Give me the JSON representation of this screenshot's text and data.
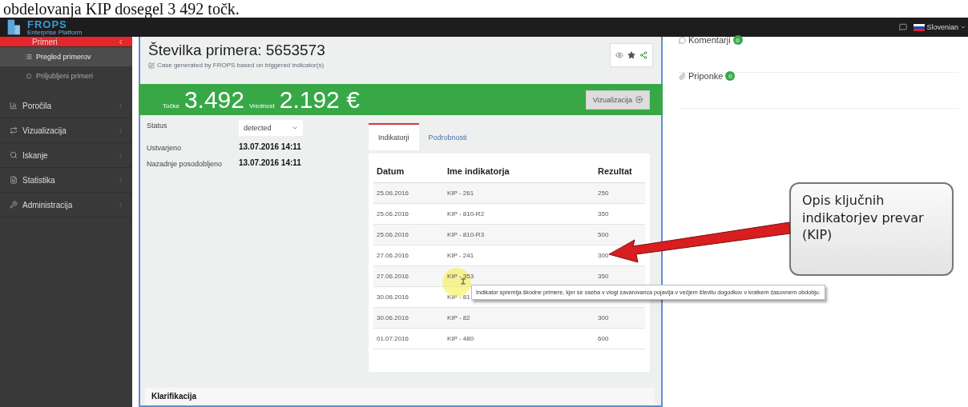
{
  "caption": "obdelovanja KIP dosegel 3 492 točk.",
  "logo": {
    "name": "FROPS",
    "tagline": "Enterprise Platform"
  },
  "header": {
    "language": "Slovenian"
  },
  "sidebar": {
    "items": [
      {
        "label": "Primeri",
        "selected": true,
        "children": [
          {
            "label": "Pregled primerov",
            "selected": true
          },
          {
            "label": "Priljubljeni primeri",
            "selected": false
          }
        ]
      },
      {
        "label": "Poročila",
        "selected": false
      },
      {
        "label": "Vizualizacija",
        "selected": false
      },
      {
        "label": "Iskanje",
        "selected": false
      },
      {
        "label": "Statistika",
        "selected": false
      },
      {
        "label": "Administracija",
        "selected": false
      }
    ]
  },
  "case": {
    "title": "Številka primera: 5653573",
    "subtitle": "Case generated by FROPS based on triggered indicator(s)",
    "points_label": "Točke",
    "points": "3.492",
    "value_label": "Vrednost",
    "value": "2.192 €",
    "visualize_button": "Vizualizacija",
    "fields": [
      {
        "label": "Status",
        "kind": "select",
        "value": "detected"
      },
      {
        "label": "Ustvarjeno",
        "kind": "text",
        "value": "13.07.2016 14:11"
      },
      {
        "label": "Nazadnje posodobljeno",
        "kind": "text",
        "value": "13.07.2016 14:11"
      }
    ],
    "tabs": [
      {
        "label": "Indikatorji",
        "selected": true
      },
      {
        "label": "Podrobnosti",
        "selected": false
      }
    ],
    "table": {
      "columns": [
        "Datum",
        "Ime indikatorja",
        "Rezultat"
      ],
      "rows": [
        {
          "cells": [
            "25.06.2016",
            "KIP - 261",
            "250"
          ]
        },
        {
          "cells": [
            "25.06.2016",
            "KIP - 810-R2",
            "350"
          ]
        },
        {
          "cells": [
            "25.06.2016",
            "KIP - 810-R3",
            "500"
          ]
        },
        {
          "cells": [
            "27.06.2016",
            "KIP - 241",
            "300"
          ]
        },
        {
          "cells": [
            "27.06.2016",
            "KIP - 353",
            "350"
          ]
        },
        {
          "cells": [
            "30.06.2016",
            "KIP - 81"
          ]
        },
        {
          "cells": [
            "30.06.2016",
            "KIP - 82",
            "300"
          ]
        },
        {
          "cells": [
            "01.07.2016",
            "KIP - 480",
            "600"
          ]
        }
      ]
    },
    "clarification": "Klarifikacija"
  },
  "side_panel": [
    {
      "label": "Komentarji",
      "count": "0"
    },
    {
      "label": "Priponke",
      "count": "0"
    }
  ],
  "tooltip": "Indikator spremlja škodne primere, kjer se oseba v vlogi zavarovanca pojavlja v večjem številu dogodkov v kratkem časovnem obdobju.",
  "callout": "Opis ključnih indikatorjev prevar (KIP)"
}
